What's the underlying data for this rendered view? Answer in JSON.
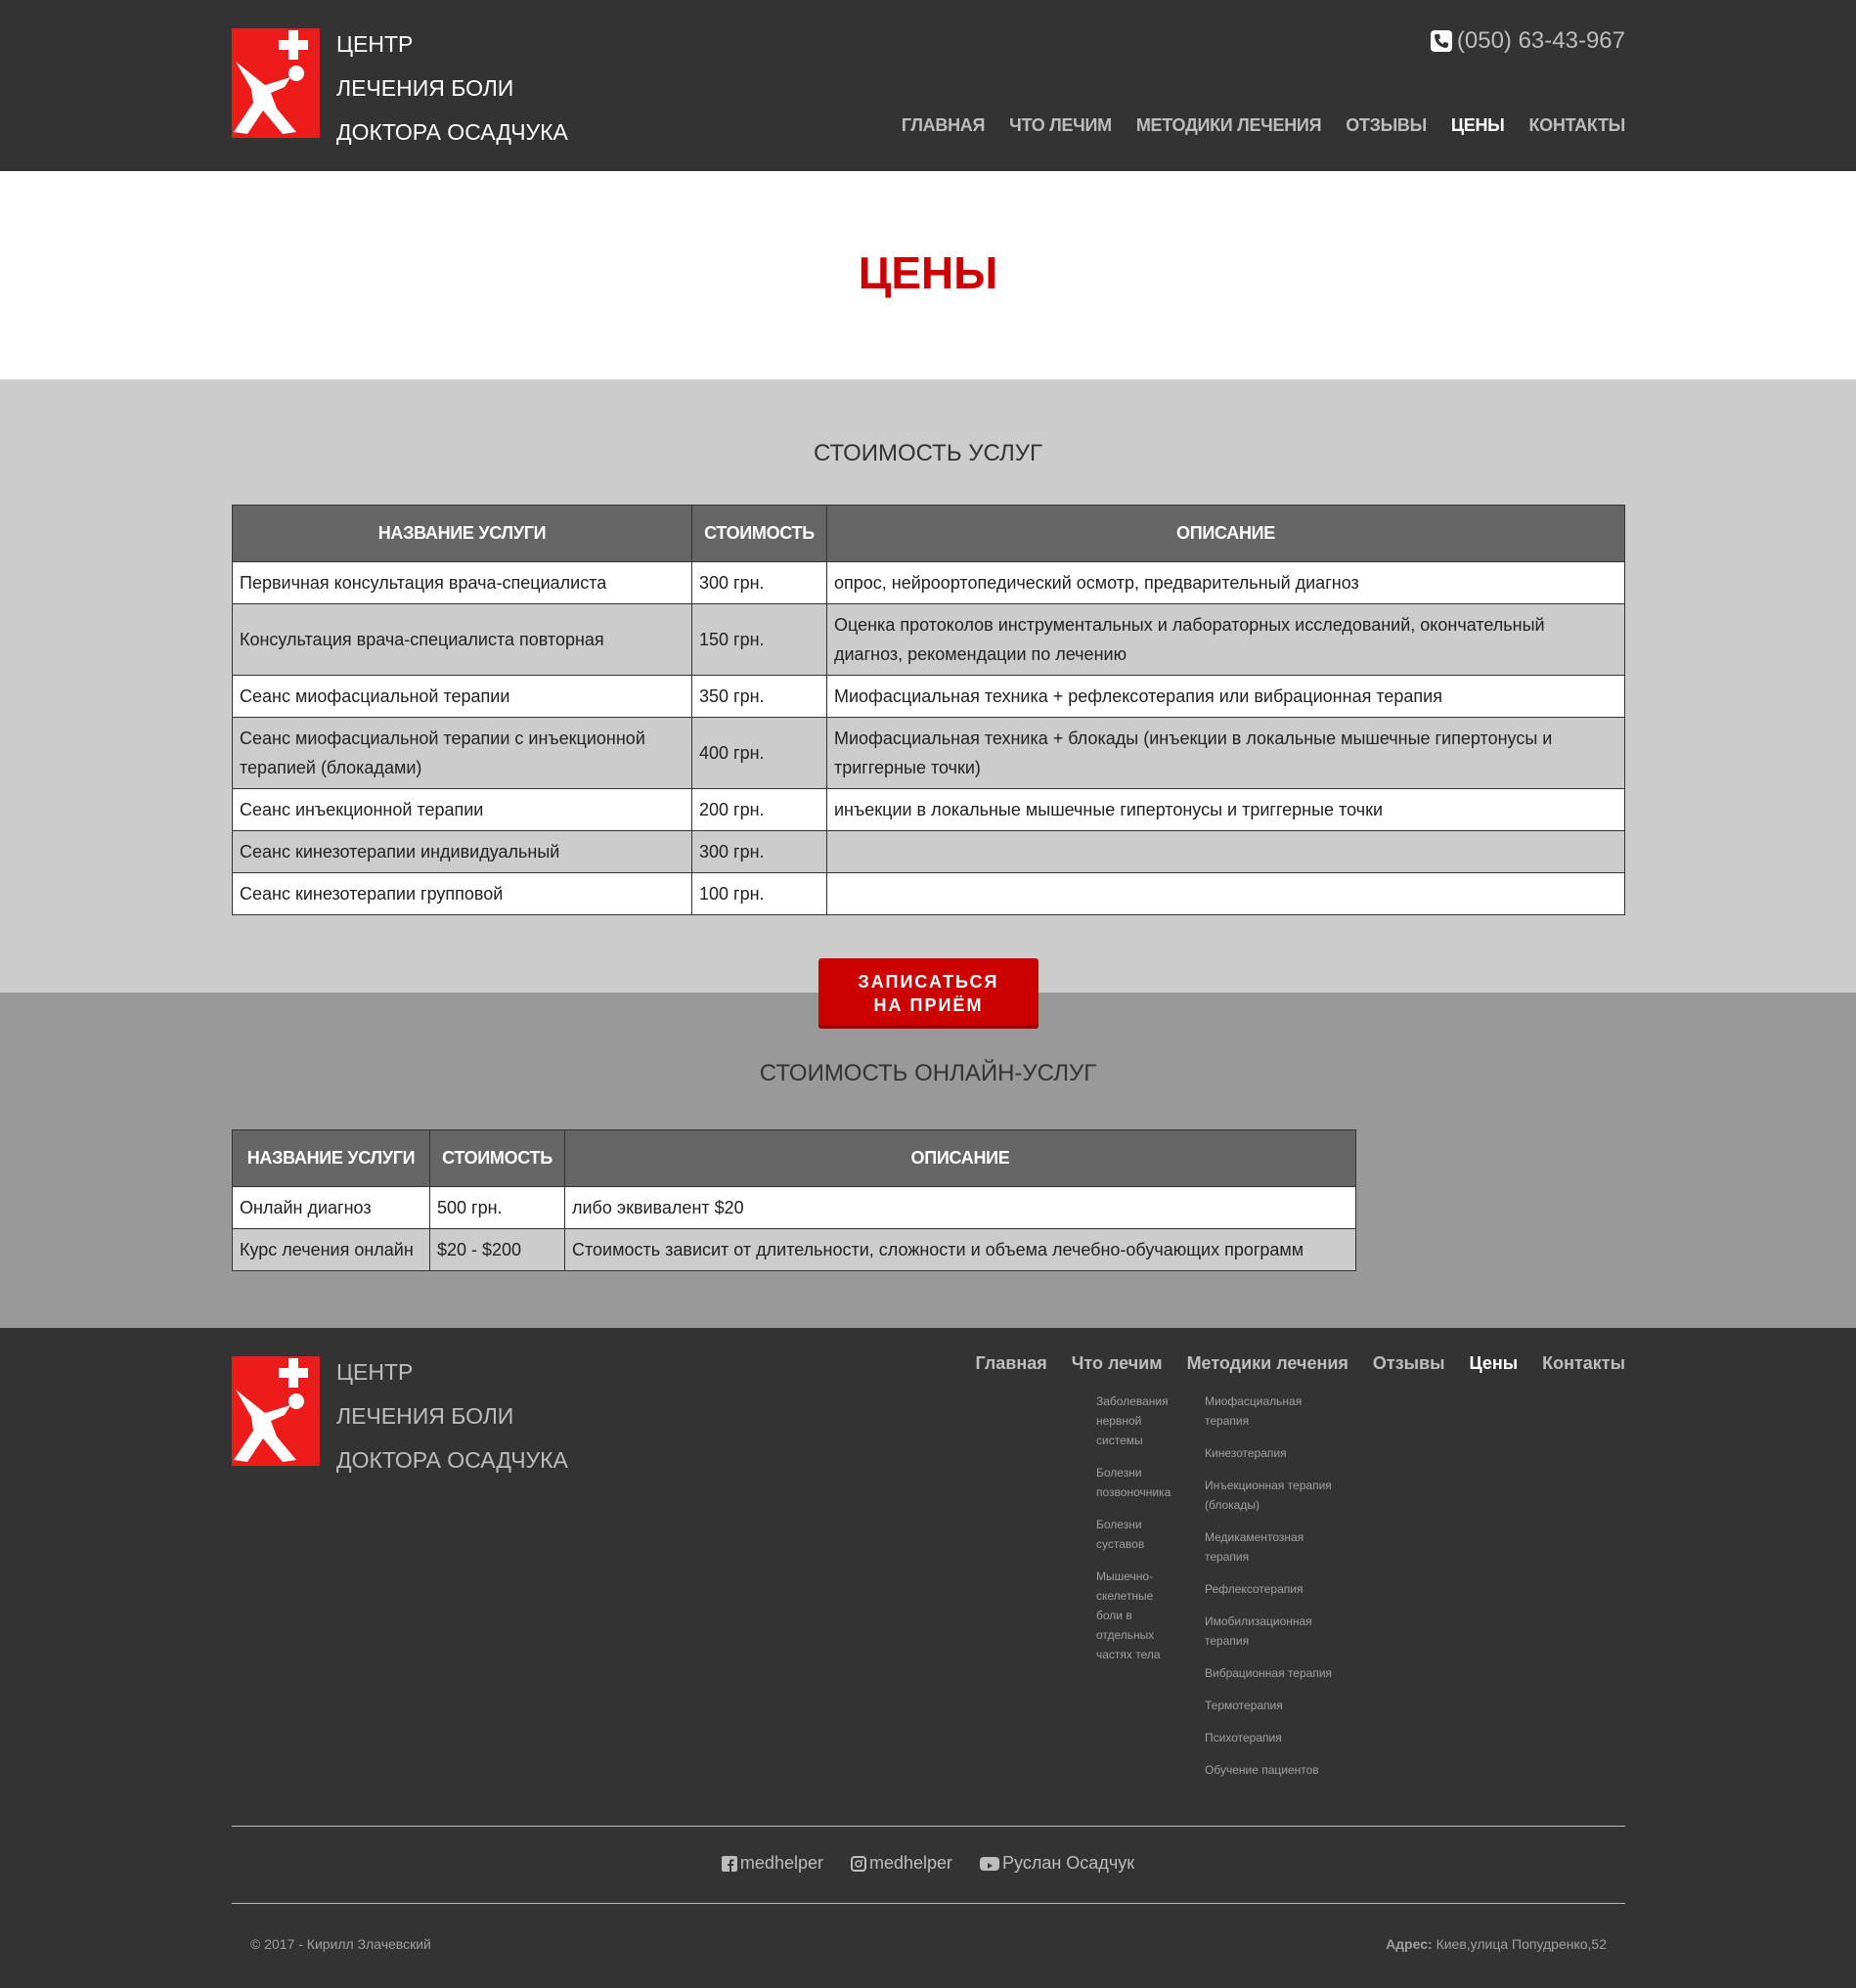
{
  "header": {
    "logo_lines": [
      "ЦЕНТР",
      "ЛЕЧЕНИЯ БОЛИ",
      "ДОКТОРА ОСАДЧУКА"
    ],
    "phone": "(050) 63-43-967",
    "nav": [
      "ГЛАВНАЯ",
      "ЧТО ЛЕЧИМ",
      "МЕТОДИКИ ЛЕЧЕНИЯ",
      "ОТЗЫВЫ",
      "ЦЕНЫ",
      "КОНТАКТЫ"
    ],
    "active_nav": "ЦЕНЫ"
  },
  "page_title": "ЦЕНЫ",
  "services": {
    "heading": "СТОИМОСТЬ УСЛУГ",
    "columns": [
      "НАЗВАНИЕ УСЛУГИ",
      "СТОИМОСТЬ",
      "ОПИСАНИЕ"
    ],
    "rows": [
      {
        "name": "Первичная консультация врача-специалиста",
        "price": "300 грн.",
        "desc": "опрос, нейроортопедический осмотр, предварительный диагноз"
      },
      {
        "name": "Консультация врача-специалиста повторная",
        "price": "150 грн.",
        "desc": "Оценка протоколов инструментальных и лабораторных исследований, окончательный диагноз, рекомендации по лечению"
      },
      {
        "name": "Сеанс миофасциальной терапии",
        "price": "350 грн.",
        "desc": "Миофасциальная техника + рефлексотерапия или вибрационная терапия"
      },
      {
        "name": "Сеанс миофасциальной терапии с инъекционной терапией (блокадами)",
        "price": "400 грн.",
        "desc": "Миофасциальная техника + блокады (инъекции в локальные мышечные гипертонусы и триггерные точки)"
      },
      {
        "name": "Сеанс инъекционной терапии",
        "price": "200 грн.",
        "desc": "инъекции в локальные мышечные гипертонусы и триггерные точки"
      },
      {
        "name": "Сеанс кинезотерапии индивидуальный",
        "price": "300 грн.",
        "desc": ""
      },
      {
        "name": "Сеанс кинезотерапии групповой",
        "price": "100 грн.",
        "desc": ""
      }
    ]
  },
  "cta_button": {
    "line1": "ЗАПИСАТЬСЯ",
    "line2": "НА ПРИЁМ"
  },
  "online": {
    "heading": "СТОИМОСТЬ ОНЛАЙН-УСЛУГ",
    "columns": [
      "НАЗВАНИЕ УСЛУГИ",
      "СТОИМОСТЬ",
      "ОПИСАНИЕ"
    ],
    "rows": [
      {
        "name": "Онлайн диагноз",
        "price": "500 грн.",
        "desc": "либо эквивалент $20"
      },
      {
        "name": "Курс лечения онлайн",
        "price": "$20 - $200",
        "desc": "Стоимость зависит от длительности, сложности и объема лечебно-обучающих программ"
      }
    ]
  },
  "footer": {
    "logo_lines": [
      "ЦЕНТР",
      "ЛЕЧЕНИЯ БОЛИ",
      "ДОКТОРА ОСАДЧУКА"
    ],
    "nav": [
      "Главная",
      "Что лечим",
      "Методики лечения",
      "Отзывы",
      "Цены",
      "Контакты"
    ],
    "what_we_treat": [
      "Заболевания нервной системы",
      "Болезни позвоночника",
      "Болезни суставов",
      "Мышечно-скелетные боли в отдельных частях тела"
    ],
    "methods": [
      "Миофасциальная терапия",
      "Кинезотерапия",
      "Инъекционная терапия (блокады)",
      "Медикаментозная терапия",
      "Рефлексотерапия",
      "Имобилизационная терапия",
      "Вибрационная терапия",
      "Термотерапия",
      "Психотерапия",
      "Обучение пациентов"
    ],
    "social": [
      {
        "icon": "facebook-icon",
        "label": "medhelper"
      },
      {
        "icon": "instagram-icon",
        "label": "medhelper"
      },
      {
        "icon": "youtube-icon",
        "label": "Руслан Осадчук"
      }
    ],
    "copyright": "© 2017 - Кирилл Злачевский",
    "address_label": "Адрес:",
    "address": "Киев,улица Попудренко,52"
  },
  "colors": {
    "accent": "#cc0000",
    "dark": "#333333",
    "logo_red": "#ee1b1b"
  }
}
